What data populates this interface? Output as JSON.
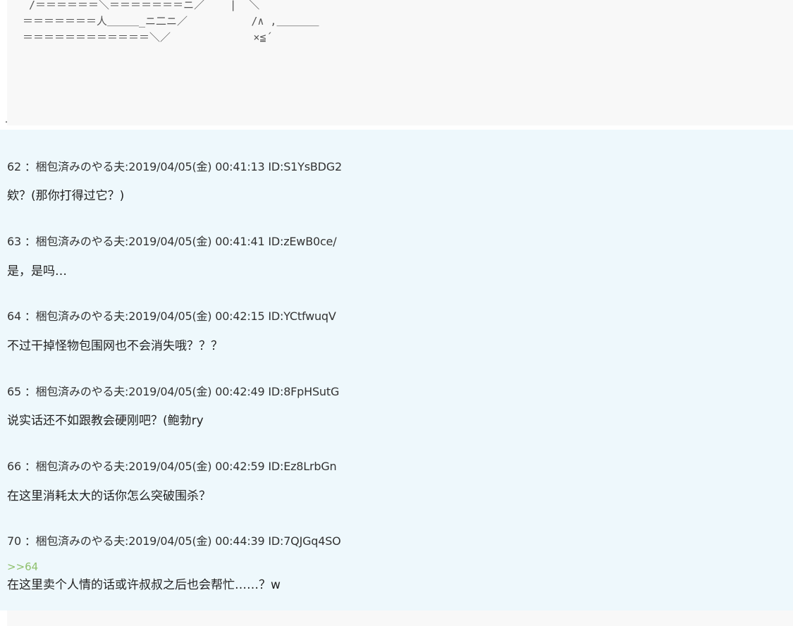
{
  "ascii_art": " /＝＝＝＝＝＝＼＝＝＝＝＝＝＝ニ／    |  ＼\n＝＝＝＝＝＝＝人＿＿＿_ニ二ニ／          /∧ ,＿＿＿＿\n＝＝＝＝＝＝＝＝＝＝＝＝＼／             ×≦´",
  "posts": [
    {
      "header": "62 ：梱包済みのやる夫:2019/04/05(金) 00:41:13 ID:S1YsBDG2",
      "body": "欸？(那你打得过它？)"
    },
    {
      "header": "63 ：梱包済みのやる夫:2019/04/05(金) 00:41:41 ID:zEwB0ce/",
      "body": "是，是吗…"
    },
    {
      "header": "64 ：梱包済みのやる夫:2019/04/05(金) 00:42:15 ID:YCtfwuqV",
      "body": "不过干掉怪物包围网也不会消失哦？？？"
    },
    {
      "header": "65 ：梱包済みのやる夫:2019/04/05(金) 00:42:49 ID:8FpHSutG",
      "body": "说实话还不如跟教会硬刚吧？(鲍勃ry"
    },
    {
      "header": "66 ：梱包済みのやる夫:2019/04/05(金) 00:42:59 ID:Ez8LrbGn",
      "body": "在这里消耗太大的话你怎么突破围杀？"
    },
    {
      "header": "70 ：梱包済みのやる夫:2019/04/05(金) 00:44:39 ID:7QJGq4SO",
      "reply_link": ">>64",
      "body": "在这里卖个人情的话或许叔叔之后也会帮忙……？w"
    }
  ],
  "colors": {
    "thread_background": "#eef8fc",
    "aa_background": "#f8f8f8",
    "reply_link": "#8ec06c"
  }
}
